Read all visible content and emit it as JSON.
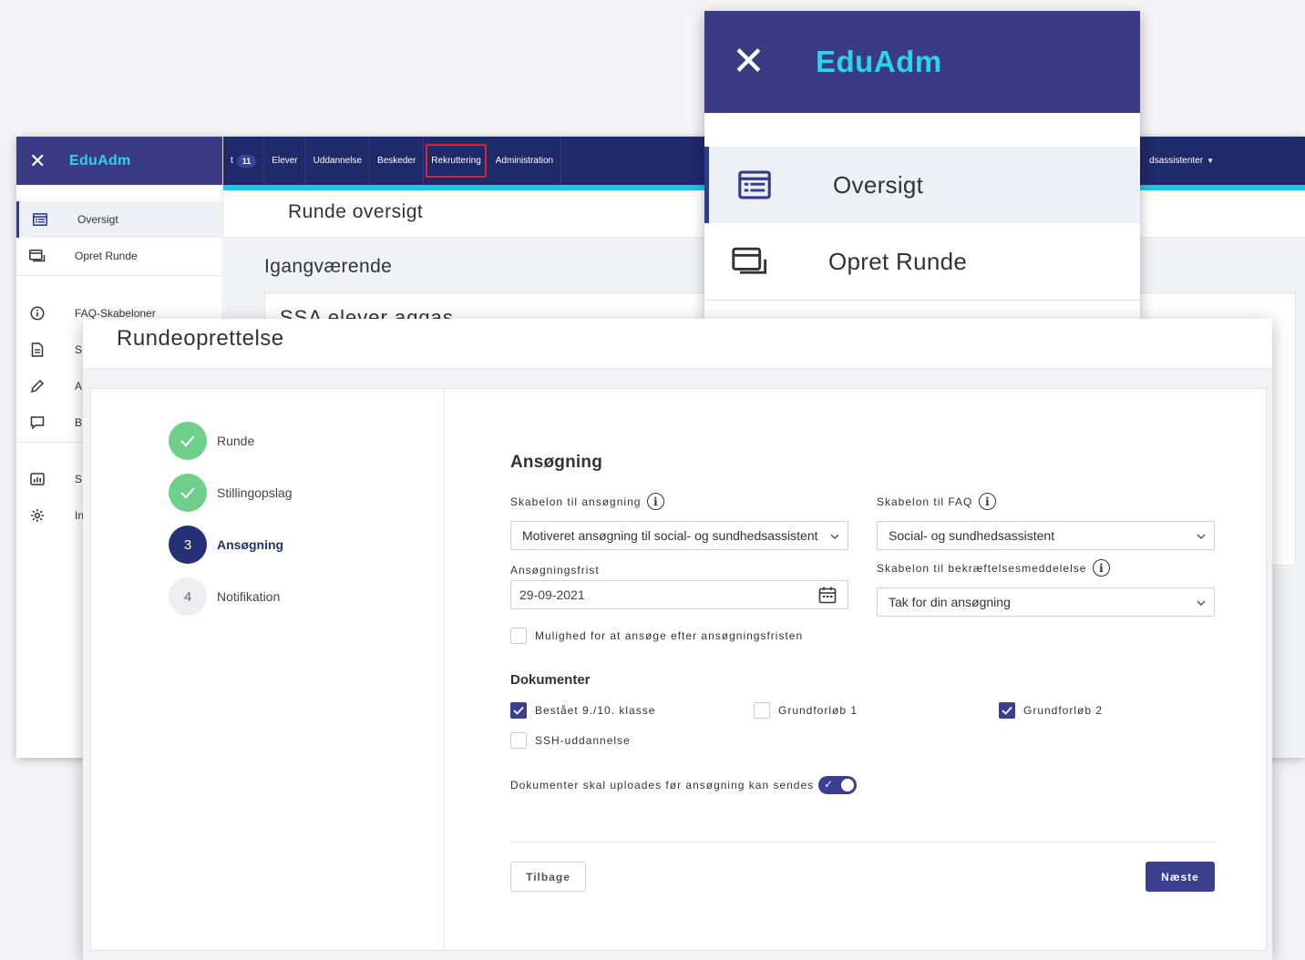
{
  "brand": "EduAdm",
  "nav": {
    "tabs": [
      {
        "label": "t",
        "badge": "11"
      },
      {
        "label": "Elever"
      },
      {
        "label": "Uddannelse"
      },
      {
        "label": "Beskeder"
      },
      {
        "label": "Rekruttering"
      },
      {
        "label": "Administration"
      }
    ],
    "user_menu": "dsassistenter"
  },
  "sidebar": {
    "items": [
      {
        "label": "Oversigt",
        "icon": "list-icon"
      },
      {
        "label": "Opret Runde",
        "icon": "window-add-icon"
      },
      {
        "label": "FAQ-Skabeloner",
        "icon": "info-icon"
      },
      {
        "label": "S",
        "icon": "document-icon"
      },
      {
        "label": "A",
        "icon": "pencil-icon"
      },
      {
        "label": "B",
        "icon": "chat-icon"
      },
      {
        "label": "S",
        "icon": "chart-icon"
      },
      {
        "label": "In",
        "icon": "settings-icon"
      }
    ]
  },
  "page": {
    "title": "Runde oversigt",
    "subtitle": "Igangværende",
    "card_title": "SSA elever aggas"
  },
  "zoom": {
    "items": [
      {
        "label": "Oversigt"
      },
      {
        "label": "Opret Runde"
      }
    ]
  },
  "modal": {
    "title": "Rundeoprettelse",
    "steps": [
      {
        "number": "",
        "label": "Runde",
        "state": "done"
      },
      {
        "number": "",
        "label": "Stillingopslag",
        "state": "done"
      },
      {
        "number": "3",
        "label": "Ansøgning",
        "state": "current"
      },
      {
        "number": "4",
        "label": "Notifikation",
        "state": "todo"
      }
    ],
    "section_title": "Ansøgning",
    "template_label": "Skabelon til ansøgning",
    "template_value": "Motiveret ansøgning til social- og sundhedsassistent",
    "faq_label": "Skabelon til FAQ",
    "faq_value": "Social- og sundhedsassistent",
    "deadline_label": "Ansøgningsfrist",
    "deadline_value": "29-09-2021",
    "confirm_label": "Skabelon til bekræftelsesmeddelelse",
    "confirm_value": "Tak for din ansøgning",
    "late_apply_label": "Mulighed for at ansøge efter ansøgningsfristen",
    "late_apply_checked": false,
    "documents_title": "Dokumenter",
    "documents": [
      {
        "label": "Bestået 9./10. klasse",
        "checked": true
      },
      {
        "label": "Grundforløb 1",
        "checked": false
      },
      {
        "label": "Grundforløb 2",
        "checked": true
      },
      {
        "label": "SSH-uddannelse",
        "checked": false
      }
    ],
    "upload_required_label": "Dokumenter skal uploades før ansøgning kan sendes",
    "upload_required_on": true,
    "back_label": "Tilbage",
    "next_label": "Næste"
  },
  "colors": {
    "nav_bg": "#1f2a6b",
    "brand_bg": "#3b3a85",
    "brand_text": "#2ad4ea",
    "accent_strip": "#22c3e6",
    "primary": "#3a3f8f",
    "step_done": "#6fd08c",
    "step_current": "#253075",
    "highlight_border": "#e0222a"
  }
}
